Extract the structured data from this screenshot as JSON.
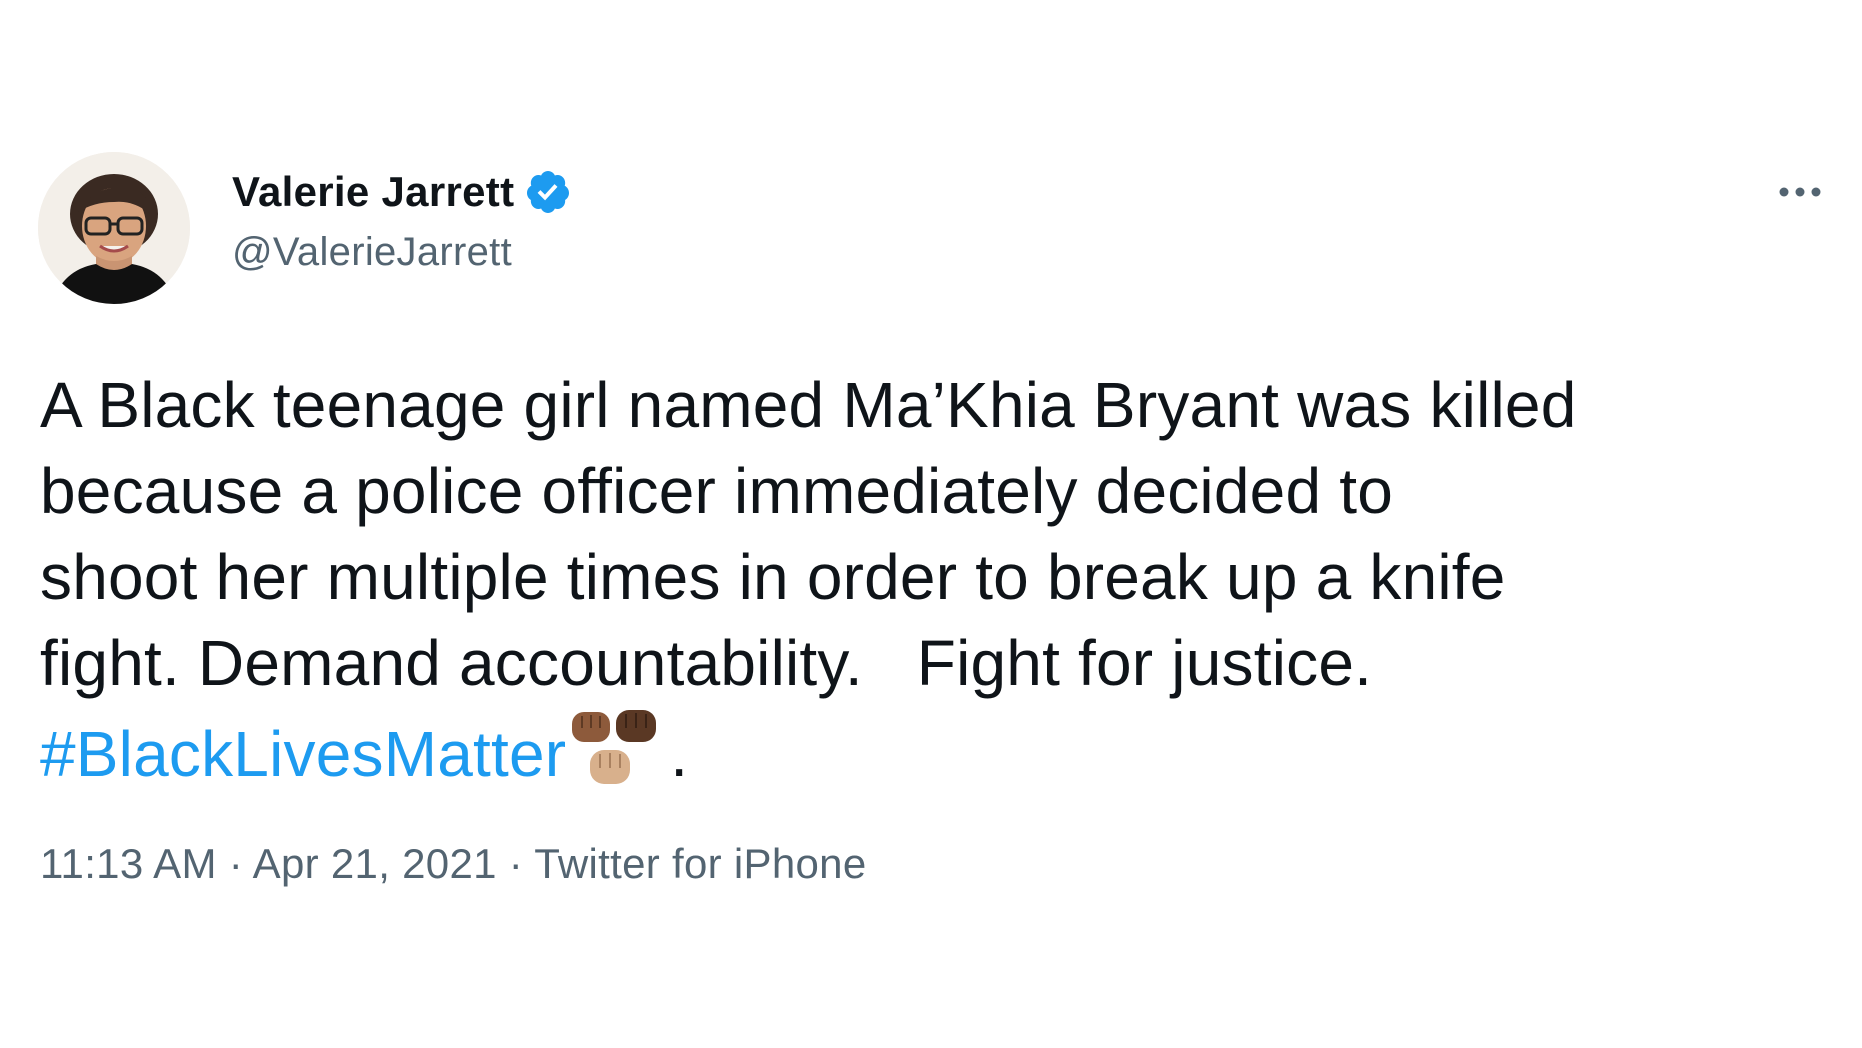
{
  "author": {
    "display_name": "Valerie Jarrett",
    "handle": "@ValerieJarrett",
    "verified": true
  },
  "tweet": {
    "lines": [
      "A Black teenage girl named Ma’Khia Bryant was killed",
      "because a police officer immediately decided to",
      "shoot her multiple times in order to break up a knife",
      "fight. Demand accountability.   Fight for justice."
    ],
    "hashtag": "#BlackLivesMatter",
    "trailing_punct": ".",
    "emoji": "raised-fists-emoji"
  },
  "meta": {
    "time": "11:13 AM",
    "separator": " · ",
    "date": "Apr 21, 2021",
    "source": "Twitter for iPhone"
  },
  "icons": {
    "verified": "verified-badge-icon",
    "more": "more-options-icon"
  },
  "colors": {
    "text": "#0f1419",
    "secondary": "#536471",
    "link": "#1d9bf0",
    "background": "#ffffff"
  }
}
